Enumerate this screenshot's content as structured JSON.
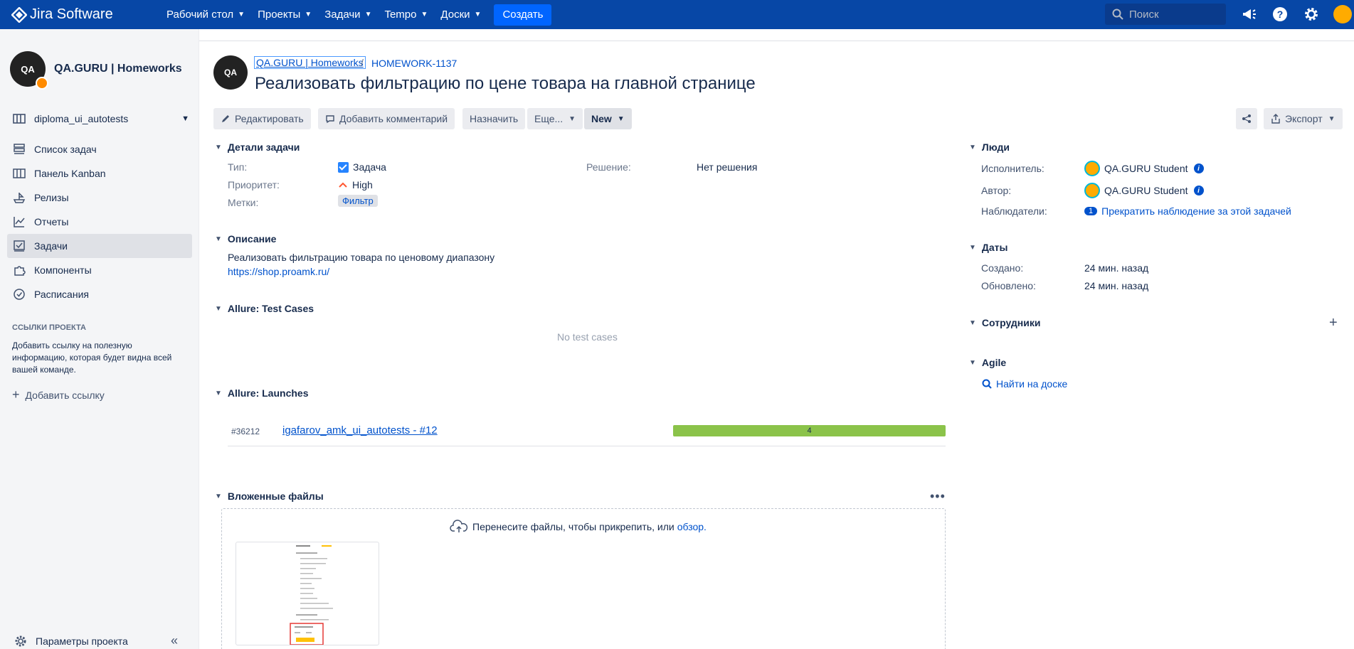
{
  "topbar": {
    "brand": "Jira Software",
    "nav": [
      "Рабочий стол",
      "Проекты",
      "Задачи",
      "Tempo",
      "Доски"
    ],
    "create_label": "Создать",
    "search_placeholder": "Поиск"
  },
  "sidebar": {
    "project_name": "QA.GURU | Homeworks",
    "board_name": "diploma_ui_autotests",
    "items": [
      {
        "label": "Список задач",
        "icon": "backlog-icon"
      },
      {
        "label": "Панель Kanban",
        "icon": "board-icon"
      },
      {
        "label": "Релизы",
        "icon": "ship-icon"
      },
      {
        "label": "Отчеты",
        "icon": "chart-icon"
      },
      {
        "label": "Задачи",
        "icon": "issues-icon",
        "active": true
      },
      {
        "label": "Компоненты",
        "icon": "puzzle-icon"
      },
      {
        "label": "Расписания",
        "icon": "clock-icon"
      }
    ],
    "links_title": "ССЫЛКИ ПРОЕКТА",
    "links_desc": "Добавить ссылку на полезную информацию, которая будет видна всей вашей команде.",
    "add_link": "Добавить ссылку",
    "project_settings": "Параметры проекта"
  },
  "issue": {
    "breadcrumb_project": "QA.GURU | Homeworks",
    "key": "HOMEWORK-1137",
    "title": "Реализовать фильтрацию по цене товара на главной странице"
  },
  "toolbar": {
    "edit": "Редактировать",
    "comment": "Добавить комментарий",
    "assign": "Назначить",
    "more": "Еще...",
    "status": "New",
    "export": "Экспорт"
  },
  "details": {
    "title": "Детали задачи",
    "type_label": "Тип:",
    "type_value": "Задача",
    "priority_label": "Приоритет:",
    "priority_value": "High",
    "labels_label": "Метки:",
    "labels_value": "Фильтр",
    "resolution_label": "Решение:",
    "resolution_value": "Нет решения"
  },
  "description": {
    "title": "Описание",
    "text": "Реализовать фильтрацию товара по ценовому диапазону",
    "link": "https://shop.proamk.ru/"
  },
  "allure_tests": {
    "title": "Allure: Test Cases",
    "empty": "No test cases"
  },
  "allure_launches": {
    "title": "Allure: Launches",
    "launch_id": "#36212",
    "launch_name": "igafarov_amk_ui_autotests - #12",
    "passed_count": "4"
  },
  "attachments": {
    "title": "Вложенные файлы",
    "drop_text": "Перенесите файлы, чтобы прикрепить, или",
    "browse": "обзор."
  },
  "people": {
    "title": "Люди",
    "assignee_label": "Исполнитель:",
    "assignee": "QA.GURU Student",
    "reporter_label": "Автор:",
    "reporter": "QA.GURU Student",
    "watchers_label": "Наблюдатели:",
    "watchers_count": "1",
    "watch_action": "Прекратить наблюдение за этой задачей"
  },
  "dates": {
    "title": "Даты",
    "created_label": "Создано:",
    "created": "24 мин. назад",
    "updated_label": "Обновлено:",
    "updated": "24 мин. назад"
  },
  "employees": {
    "title": "Сотрудники"
  },
  "agile": {
    "title": "Agile",
    "link": "Найти на доске"
  },
  "colors": {
    "topbar": "#0747a6",
    "link": "#0052cc",
    "passed": "#8bc34a"
  }
}
